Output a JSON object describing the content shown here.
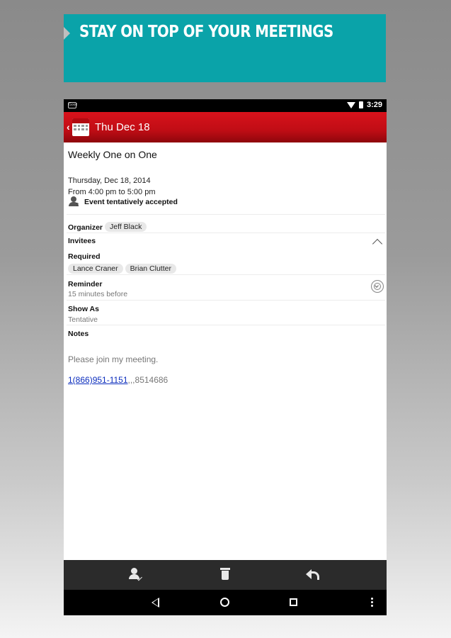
{
  "banner": {
    "title": "STAY ON TOP OF YOUR MEETINGS",
    "color": "#0aa3a9"
  },
  "status_bar": {
    "time": "3:29",
    "left_icon": "Good"
  },
  "app_bar": {
    "title": "Thu Dec 18",
    "accent": "#c00d15"
  },
  "event": {
    "title": "Weekly One on One",
    "date": "Thursday, Dec 18, 2014",
    "time": "From 4:00 pm to 5:00 pm",
    "status": "Event tentatively accepted"
  },
  "organizer": {
    "label": "Organizer",
    "name": "Jeff Black"
  },
  "invitees": {
    "label": "Invitees",
    "required_label": "Required",
    "required": [
      "Lance Craner",
      "Brian Clutter"
    ]
  },
  "reminder": {
    "label": "Reminder",
    "value": "15 minutes before"
  },
  "show_as": {
    "label": "Show As",
    "value": "Tentative"
  },
  "notes": {
    "label": "Notes",
    "body": "Please join my meeting.",
    "phone_link": "1(866)951-1151",
    "phone_suffix": ",,,8514686"
  },
  "toolbar": {
    "icons": [
      "accept-icon",
      "delete-icon",
      "reply-icon"
    ]
  },
  "navigation": {
    "icons": [
      "back-icon",
      "home-icon",
      "recents-icon",
      "menu-icon"
    ]
  }
}
